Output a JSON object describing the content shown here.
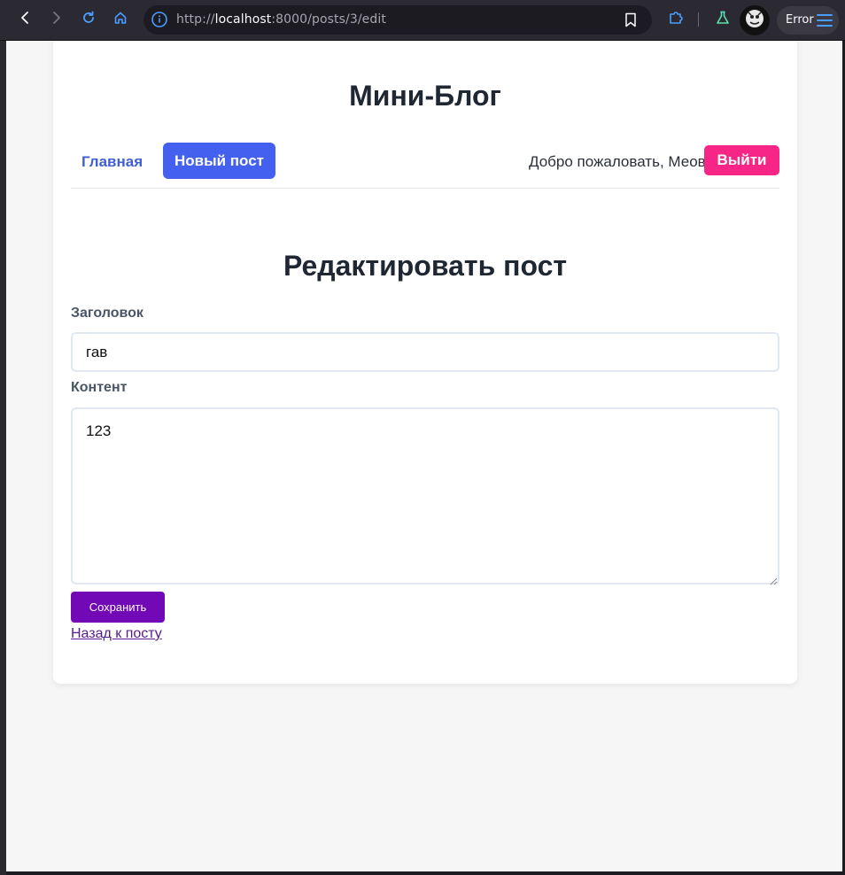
{
  "browser": {
    "url_scheme": "http://",
    "url_host": "localhost",
    "url_rest": ":8000/posts/3/edit",
    "status_label": "Error",
    "accent_color": "#4a9eff"
  },
  "site": {
    "title": "Мини-Блог"
  },
  "nav": {
    "home_label": "Главная",
    "new_post_label": "Новый пост",
    "welcome_text": "Добро пожаловать, Меов",
    "logout_label": "Выйти"
  },
  "form": {
    "heading": "Редактировать пост",
    "title_label": "Заголовок",
    "title_value": "гав",
    "content_label": "Контент",
    "content_value": "123",
    "save_label": "Сохранить",
    "back_label": "Назад к посту"
  },
  "colors": {
    "primary": "#4361ee",
    "logout": "#f72585",
    "save": "#7209b7"
  }
}
